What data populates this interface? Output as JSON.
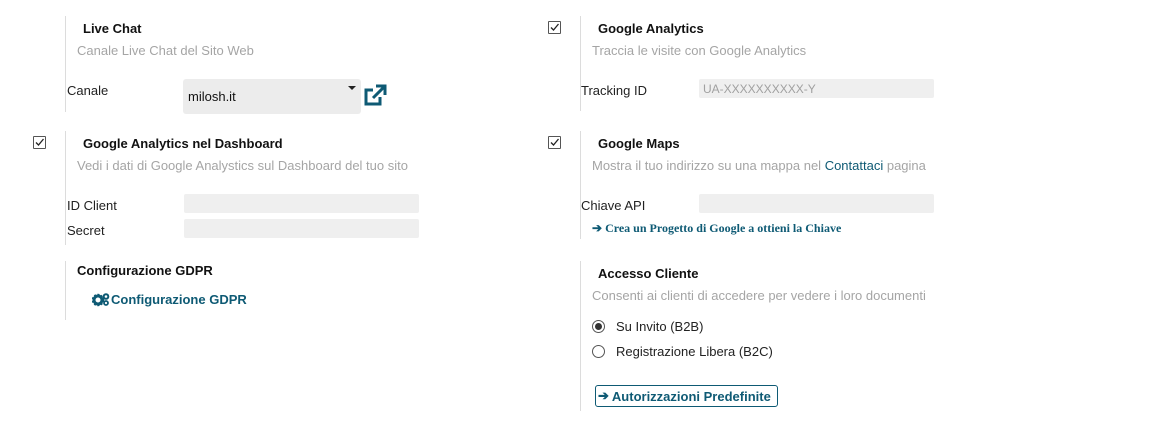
{
  "live_chat": {
    "title": "Live Chat",
    "description": "Canale Live Chat del Sito Web",
    "canale_label": "Canale",
    "canale_value": "milosh.it",
    "external_icon": "external-link-icon"
  },
  "ga_dashboard": {
    "checked": true,
    "title": "Google Analytics nel Dashboard",
    "description": "Vedi i dati di Google Analystics sul Dashboard del tuo sito",
    "id_client_label": "ID Client",
    "id_client_value": "",
    "secret_label": "Secret",
    "secret_value": ""
  },
  "gdpr": {
    "title": "Configurazione GDPR",
    "link_label": "Configurazione GDPR",
    "icon": "gears-icon"
  },
  "google_analytics": {
    "checked": true,
    "title": "Google Analytics",
    "description": "Traccia le visite con Google Analytics",
    "tracking_label": "Tracking ID",
    "tracking_placeholder": "UA-XXXXXXXXXX-Y"
  },
  "google_maps": {
    "checked": true,
    "title": "Google Maps",
    "description_before": "Mostra il tuo indirizzo su una mappa nel ",
    "description_link": "Contattaci",
    "description_after": " pagina",
    "api_label": "Chiave API",
    "api_value": "",
    "project_link": "Crea un Progetto di Google a ottieni la Chiave"
  },
  "accesso_cliente": {
    "title": "Accesso Cliente",
    "description": "Consenti ai clienti di accedere per vedere i loro documenti",
    "options": [
      "Su Invito (B2B)",
      "Registrazione Libera (B2C)"
    ],
    "selected_index": 0,
    "button_label": "Autorizzazioni Predefinite"
  },
  "colors": {
    "accent": "#0e5a74",
    "field_bg": "#efefef",
    "muted_text": "#a5a5a5"
  }
}
